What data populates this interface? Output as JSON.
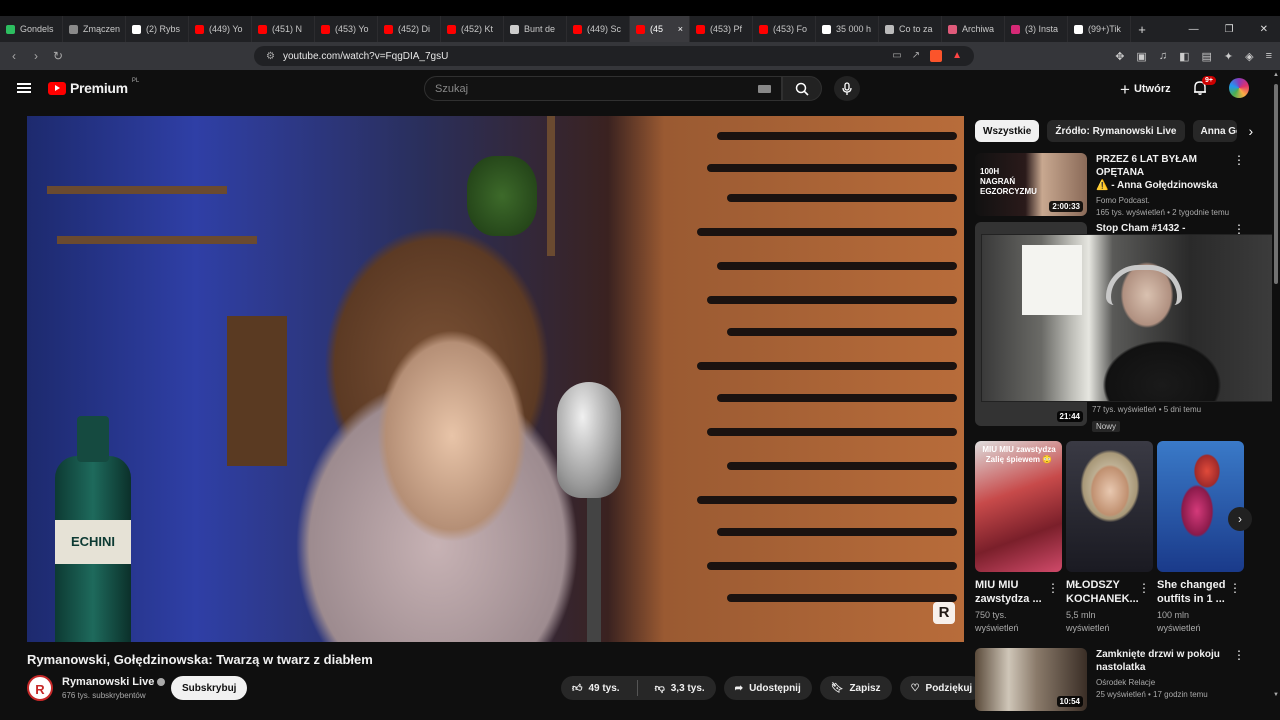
{
  "browser": {
    "tabs": [
      {
        "label": "Gondels",
        "color": "#2dbe60"
      },
      {
        "label": "Zmączen",
        "color": "#8a8a8a"
      },
      {
        "label": "(2) Rybs",
        "color": "#ffffff"
      },
      {
        "label": "(449) Yo",
        "color": "#ff0000"
      },
      {
        "label": "(451) N",
        "color": "#ff0000"
      },
      {
        "label": "(453) Yo",
        "color": "#ff0000"
      },
      {
        "label": "(452) Di",
        "color": "#ff0000"
      },
      {
        "label": "(452) Kt",
        "color": "#ff0000"
      },
      {
        "label": "Bunt de",
        "color": "#cccccc"
      },
      {
        "label": "(449) Sc",
        "color": "#ff0000"
      },
      {
        "label": "(45",
        "color": "#ff0000",
        "active": true
      },
      {
        "label": "(453) Pf",
        "color": "#ff0000"
      },
      {
        "label": "(453) Fo",
        "color": "#ff0000"
      },
      {
        "label": "35 000 h",
        "color": "#ffffff"
      },
      {
        "label": "Co to za",
        "color": "#bbbbbb"
      },
      {
        "label": "Archiwa",
        "color": "#e05a7a"
      },
      {
        "label": "(3) Insta",
        "color": "#d62976"
      },
      {
        "label": "(99+)Tik",
        "color": "#ffffff"
      }
    ],
    "url": "youtube.com/watch?v=FqgDIA_7gsU"
  },
  "header": {
    "logo_text": "Premium",
    "logo_country": "PL",
    "search_placeholder": "Szukaj",
    "create_label": "Utwórz",
    "notif_count": "9+"
  },
  "video": {
    "title": "Rymanowski, Gołędzinowska: Twarzą w twarz z diabłem",
    "bottle_label": "ECHINI",
    "watermark": "R"
  },
  "channel": {
    "name": "Rymanowski Live",
    "subs": "676 tys. subskrybentów",
    "avatar_letter": "R",
    "subscribe_label": "Subskrybuj"
  },
  "actions": {
    "likes": "49 tys.",
    "dislikes": "3,3 tys.",
    "share": "Udostępnij",
    "save": "Zapisz",
    "thanks": "Podziękuj"
  },
  "chips": [
    "Wszystkie",
    "Źródło: Rymanowski Live",
    "Anna Go"
  ],
  "recommendations": [
    {
      "title_line1": "PRZEZ 6 LAT BYŁAM OPĘTANA",
      "title_line2": "⚠️ - Anna Gołędzinowska",
      "channel": "Fomo Podcast.",
      "meta": "165 tys. wyświetleń • 2 tygodnie temu",
      "duration": "2:00:33",
      "thumb_text": "100H NAGRAŃ EGZORCYZMU"
    },
    {
      "title_line1": "Stop Cham #1432 -",
      "meta": "77 tys. wyświetleń • 5 dni temu",
      "badge": "Nowy",
      "duration": "21:44"
    },
    {
      "title_line1": "Zamknięte drzwi w pokoju",
      "title_line2": "nastolatka",
      "channel": "Ośrodek Relacje",
      "meta": "25 wyświetleń • 17 godzin temu",
      "duration": "10:54"
    }
  ],
  "shorts": [
    {
      "title": "MIU MIU zawstydza ...",
      "views": "750 tys.",
      "views_label": "wyświetleń",
      "overlay": "MIU MIU zawstydza Zalię śpiewem 😳"
    },
    {
      "title": "MŁODSZY KOCHANEK...",
      "views": "5,5 mln",
      "views_label": "wyświetleń"
    },
    {
      "title": "She changed outfits in 1 ...",
      "views": "100 mln",
      "views_label": "wyświetleń"
    }
  ]
}
